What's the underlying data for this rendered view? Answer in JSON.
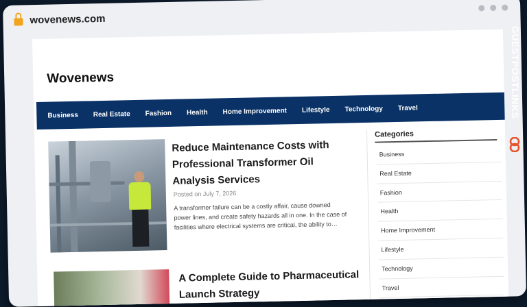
{
  "browser": {
    "url": "wovenews.com"
  },
  "site": {
    "title": "Wovenews"
  },
  "nav": {
    "items": [
      "Business",
      "Real Estate",
      "Fashion",
      "Health",
      "Home Improvement",
      "Lifestyle",
      "Technology",
      "Travel"
    ]
  },
  "articles": [
    {
      "title": "Reduce Maintenance Costs with Professional Transformer Oil Analysis Services",
      "date": "Posted on July 7, 2026",
      "excerpt": "A transformer failure can be a costly affair, cause downed power lines, and create safety hazards all in one. In the case of facilities where electrical systems are critical, the ability to…"
    },
    {
      "title": "A Complete Guide to Pharmaceutical Launch Strategy"
    }
  ],
  "sidebar": {
    "title": "Categories",
    "items": [
      "Business",
      "Real Estate",
      "Fashion",
      "Health",
      "Home Improvement",
      "Lifestyle",
      "Technology",
      "Travel"
    ]
  },
  "brand": {
    "text": "GUESTPOSTLINKS"
  },
  "colors": {
    "nav_bg": "#0a3266",
    "lock": "#f2a51c",
    "brand_accent": "#e8532c"
  }
}
